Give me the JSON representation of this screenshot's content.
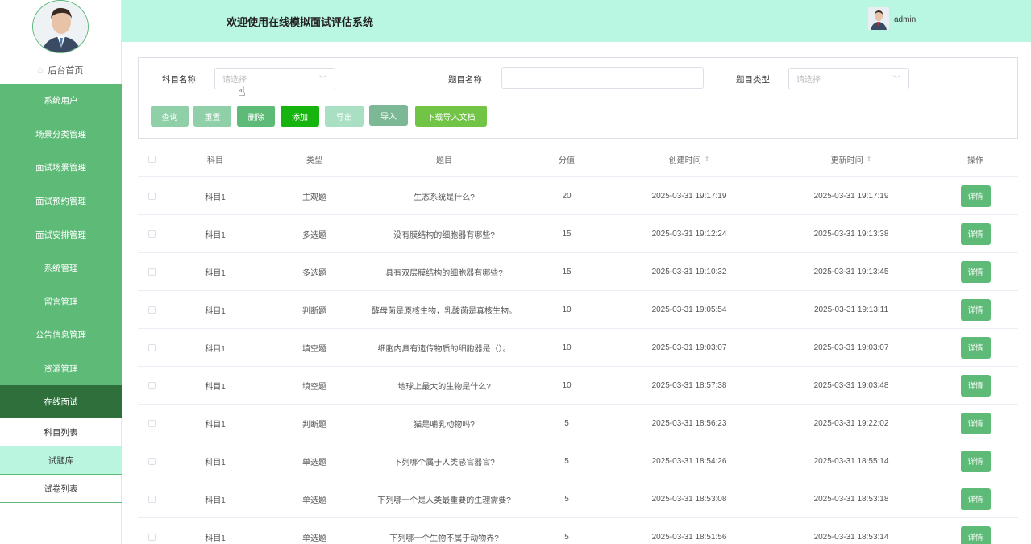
{
  "header": {
    "title": "欢迎使用在线模拟面试评估系统",
    "user_name": "admin"
  },
  "sidebar": {
    "home_label": "后台首页",
    "menu": [
      "系统用户",
      "场景分类管理",
      "面试场景管理",
      "面试预约管理",
      "面试安排管理",
      "系统管理",
      "留言管理",
      "公告信息管理",
      "资源管理",
      "在线面试"
    ],
    "submenu": [
      "科目列表",
      "试题库",
      "试卷列表"
    ]
  },
  "search": {
    "subject_label": "科目名称",
    "subject_placeholder": "请选择",
    "question_label": "题目名称",
    "type_label": "题目类型",
    "type_placeholder": "请选择",
    "buttons": {
      "query": "查询",
      "reset": "重置",
      "delete": "删除",
      "add": "添加",
      "export": "导出",
      "import": "导入",
      "download": "下载导入文档"
    }
  },
  "table": {
    "columns": [
      "科目",
      "类型",
      "题目",
      "分值",
      "创建时间",
      "更新时间",
      "操作"
    ],
    "detail_label": "详情",
    "rows": [
      [
        "科目1",
        "主观题",
        "生态系统是什么?",
        "20",
        "2025-03-31 19:17:19",
        "2025-03-31 19:17:19"
      ],
      [
        "科目1",
        "多选题",
        "没有膜结构的细胞器有哪些?",
        "15",
        "2025-03-31 19:12:24",
        "2025-03-31 19:13:38"
      ],
      [
        "科目1",
        "多选题",
        "具有双层膜结构的细胞器有哪些?",
        "15",
        "2025-03-31 19:10:32",
        "2025-03-31 19:13:45"
      ],
      [
        "科目1",
        "判断题",
        "酵母菌是原核生物，乳酸菌是真核生物。",
        "10",
        "2025-03-31 19:05:54",
        "2025-03-31 19:13:11"
      ],
      [
        "科目1",
        "填空题",
        "细胞内具有遗传物质的细胞器是（）。",
        "10",
        "2025-03-31 19:03:07",
        "2025-03-31 19:03:07"
      ],
      [
        "科目1",
        "填空题",
        "地球上最大的生物是什么?",
        "10",
        "2025-03-31 18:57:38",
        "2025-03-31 19:03:48"
      ],
      [
        "科目1",
        "判断题",
        "猫是哺乳动物吗?",
        "5",
        "2025-03-31 18:56:23",
        "2025-03-31 19:22:02"
      ],
      [
        "科目1",
        "单选题",
        "下列哪个属于人类感官器官?",
        "5",
        "2025-03-31 18:54:26",
        "2025-03-31 18:55:14"
      ],
      [
        "科目1",
        "单选题",
        "下列哪一个是人类最重要的生理需要?",
        "5",
        "2025-03-31 18:53:08",
        "2025-03-31 18:53:18"
      ],
      [
        "科目1",
        "单选题",
        "下列哪一个生物不属于动物界?",
        "5",
        "2025-03-31 18:51:56",
        "2025-03-31 18:53:14"
      ]
    ]
  }
}
